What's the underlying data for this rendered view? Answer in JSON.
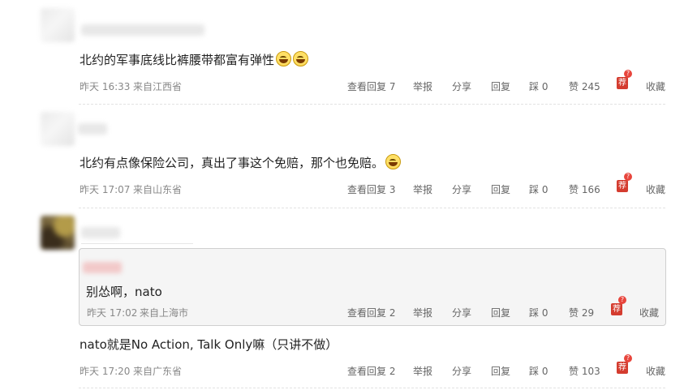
{
  "comments": [
    {
      "text": "北约的军事底线比裤腰带都富有弹性",
      "time": "昨天 16:33",
      "location": "来自江西省",
      "view_replies": "查看回复 7",
      "report": "举报",
      "share": "分享",
      "reply": "回复",
      "dislike": "踩 0",
      "like": "赞 245",
      "recommend": "荐",
      "recommend_badge": "?",
      "collect": "收藏"
    },
    {
      "text": "北约有点像保险公司，真出了事这个免赔，那个也免赔。",
      "time": "昨天 17:07",
      "location": "来自山东省",
      "view_replies": "查看回复 3",
      "report": "举报",
      "share": "分享",
      "reply": "回复",
      "dislike": "踩 0",
      "like": "赞 166",
      "recommend": "荐",
      "recommend_badge": "?",
      "collect": "收藏"
    },
    {
      "quoted": {
        "text": "别怂啊，nato",
        "time": "昨天 17:02",
        "location": "来自上海市",
        "view_replies": "查看回复 2",
        "report": "举报",
        "share": "分享",
        "reply": "回复",
        "dislike": "踩 0",
        "like": "赞 29",
        "recommend": "荐",
        "recommend_badge": "?",
        "collect": "收藏"
      },
      "text": "nato就是No Action, Talk Only嘛（只讲不做）",
      "time": "昨天 17:20",
      "location": "来自广东省",
      "view_replies": "查看回复 2",
      "report": "举报",
      "share": "分享",
      "reply": "回复",
      "dislike": "踩 0",
      "like": "赞 103",
      "recommend": "荐",
      "recommend_badge": "?",
      "collect": "收藏"
    }
  ],
  "icons": {
    "laugh": "laughing-face-emoji",
    "recommend": "recommend-badge-icon"
  },
  "colors": {
    "recommend_red": "#d43c2f",
    "meta_grey": "#888888",
    "quote_bg": "#f5f5f5"
  }
}
